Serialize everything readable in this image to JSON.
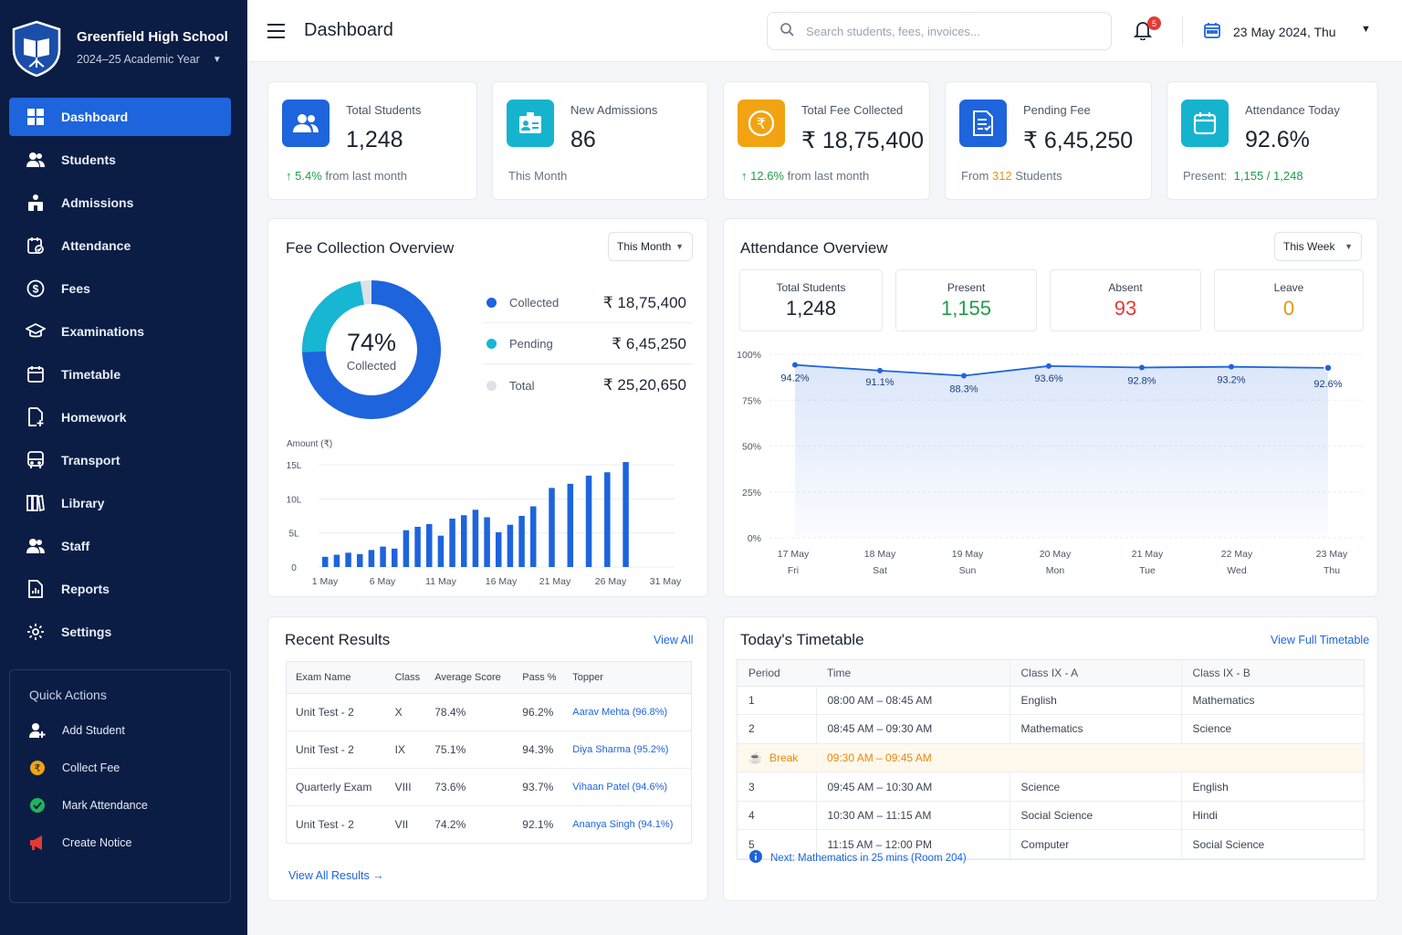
{
  "brand": {
    "school_name": "Greenfield High School",
    "academic_year": "2024–25 Academic Year"
  },
  "sidebar": {
    "items": [
      {
        "label": "Dashboard",
        "icon": "grid-icon",
        "active": true
      },
      {
        "label": "Students",
        "icon": "students-icon"
      },
      {
        "label": "Admissions",
        "icon": "admissions-icon"
      },
      {
        "label": "Attendance",
        "icon": "attendance-icon"
      },
      {
        "label": "Fees",
        "icon": "dollar-icon"
      },
      {
        "label": "Examinations",
        "icon": "graduation-cap-icon"
      },
      {
        "label": "Timetable",
        "icon": "calendar-icon"
      },
      {
        "label": "Homework",
        "icon": "document-plus-icon"
      },
      {
        "label": "Transport",
        "icon": "bus-icon"
      },
      {
        "label": "Library",
        "icon": "books-icon"
      },
      {
        "label": "Staff",
        "icon": "staff-icon"
      },
      {
        "label": "Reports",
        "icon": "report-icon"
      },
      {
        "label": "Settings",
        "icon": "gear-icon"
      }
    ],
    "quick_actions": {
      "title": "Quick Actions",
      "items": [
        {
          "label": "Add Student",
          "icon": "add-user-icon"
        },
        {
          "label": "Collect Fee",
          "icon": "rupee-coin-icon"
        },
        {
          "label": "Mark Attendance",
          "icon": "check-circle-icon"
        },
        {
          "label": "Create Notice",
          "icon": "megaphone-icon"
        }
      ]
    }
  },
  "header": {
    "title": "Dashboard",
    "search_placeholder": "Search students, fees, invoices...",
    "notification_count": "5",
    "date": "23 May 2024, Thu"
  },
  "stats": [
    {
      "label": "Total Students",
      "value": "1,248",
      "trend": "5.4%",
      "trend_text": "from last month",
      "icon": "users-icon",
      "color": "#1d64dd"
    },
    {
      "label": "New Admissions",
      "value": "86",
      "sub": "This Month",
      "icon": "id-card-icon",
      "color": "#16b3cf"
    },
    {
      "label": "Total Fee Collected",
      "value": "₹ 18,75,400",
      "trend": "12.6%",
      "trend_text": "from last month",
      "icon": "rupee-icon",
      "color": "#f2a312"
    },
    {
      "label": "Pending Fee",
      "value": "₹ 6,45,250",
      "sub_prefix": "From",
      "sub_count": "312",
      "sub_suffix": "Students",
      "icon": "invoice-icon",
      "color": "#1d64dd"
    },
    {
      "label": "Attendance Today",
      "value": "92.6%",
      "sub_prefix": "Present:",
      "sub_value": "1,155 / 1,248",
      "icon": "calendar-icon",
      "color": "#16b3cf"
    }
  ],
  "fee_overview": {
    "title": "Fee Collection Overview",
    "filter": "This Month",
    "donut_percent": "74%",
    "donut_label": "Collected",
    "donut_fraction": 0.744,
    "legend": [
      {
        "label": "Collected",
        "amount": "₹ 18,75,400",
        "color": "#1d64dd"
      },
      {
        "label": "Pending",
        "amount": "₹ 6,45,250",
        "color": "#17b6d3"
      },
      {
        "label": "Total",
        "amount": "₹ 25,20,650",
        "color": "#dde1e8"
      }
    ]
  },
  "attendance": {
    "title": "Attendance Overview",
    "filter": "This Week",
    "summary": [
      {
        "label": "Total Students",
        "value": "1,248",
        "color": "#1b2430"
      },
      {
        "label": "Present",
        "value": "1,155",
        "color": "#1e9e4a"
      },
      {
        "label": "Absent",
        "value": "93",
        "color": "#e53935"
      },
      {
        "label": "Leave",
        "value": "0",
        "color": "#e89413"
      }
    ]
  },
  "chart_data": [
    {
      "type": "bar",
      "ylabel": "Amount (₹)",
      "ytick_labels": [
        "0",
        "5L",
        "10L",
        "15L"
      ],
      "ylim": [
        0,
        15
      ],
      "xtick_labels": [
        "1 May",
        "6 May",
        "11 May",
        "16 May",
        "21 May",
        "26 May",
        "31 May"
      ],
      "categories": [
        "1",
        "2",
        "3",
        "4",
        "5",
        "6",
        "7",
        "8",
        "9",
        "10",
        "11",
        "12",
        "13",
        "14",
        "15",
        "16",
        "17",
        "18",
        "19",
        "20",
        "21",
        "22",
        "23",
        "24",
        "25",
        "26",
        "27",
        "28",
        "29",
        "30",
        "31"
      ],
      "values": [
        1.5,
        1.8,
        2.1,
        1.9,
        2.5,
        3.0,
        2.7,
        5.4,
        5.9,
        6.3,
        4.6,
        7.1,
        7.6,
        8.4,
        7.3,
        5.1,
        6.2,
        7.5,
        8.9,
        11.6,
        12.2,
        13.4,
        13.9,
        15.4
      ],
      "xindex": [
        1,
        2,
        3,
        4,
        5,
        6,
        7,
        8,
        9,
        10,
        11,
        12,
        13,
        14,
        15,
        16,
        17,
        18,
        19,
        20,
        21,
        22,
        23,
        24
      ],
      "color": "#1d64dd",
      "grid": true
    },
    {
      "type": "area",
      "ytick_labels": [
        "0%",
        "25%",
        "50%",
        "75%",
        "100%"
      ],
      "ylim": [
        0,
        100
      ],
      "x_dates": [
        "17 May",
        "18 May",
        "19 May",
        "20 May",
        "21 May",
        "22 May",
        "23 May"
      ],
      "x_days": [
        "Fri",
        "Sat",
        "Sun",
        "Mon",
        "Tue",
        "Wed",
        "Thu"
      ],
      "values": [
        94.2,
        91.1,
        88.3,
        93.6,
        92.8,
        93.2,
        92.6
      ],
      "labels": [
        "94.2%",
        "91.1%",
        "88.3%",
        "93.6%",
        "92.8%",
        "93.2%",
        "92.6%"
      ],
      "color": "#1d64dd",
      "grid": true
    }
  ],
  "results": {
    "title": "Recent Results",
    "view_all": "View All",
    "columns": [
      "Exam Name",
      "Class",
      "Average Score",
      "Pass %",
      "Topper"
    ],
    "rows": [
      [
        "Unit Test - 2",
        "X",
        "78.4%",
        "96.2%",
        "Aarav Mehta (96.8%)"
      ],
      [
        "Unit Test - 2",
        "IX",
        "75.1%",
        "94.3%",
        "Diya Sharma (95.2%)"
      ],
      [
        "Quarterly Exam",
        "VIII",
        "73.6%",
        "93.7%",
        "Vihaan Patel (94.6%)"
      ],
      [
        "Unit Test - 2",
        "VII",
        "74.2%",
        "92.1%",
        "Ananya Singh (94.1%)"
      ]
    ],
    "view_all_results": "View All Results"
  },
  "timetable": {
    "title": "Today's Timetable",
    "view_full": "View Full Timetable",
    "columns": [
      "Period",
      "Time",
      "Class IX - A",
      "Class IX - B"
    ],
    "rows": [
      [
        "1",
        "08:00 AM – 08:45 AM",
        "English",
        "Mathematics"
      ],
      [
        "2",
        "08:45 AM – 09:30 AM",
        "Mathematics",
        "Science"
      ],
      [
        "Break",
        "09:30 AM – 09:45 AM",
        "",
        ""
      ],
      [
        "3",
        "09:45 AM – 10:30 AM",
        "Science",
        "English"
      ],
      [
        "4",
        "10:30 AM – 11:15 AM",
        "Social Science",
        "Hindi"
      ],
      [
        "5",
        "11:15 AM – 12:00 PM",
        "Computer",
        "Social Science"
      ]
    ],
    "next": "Next: Mathematics in 25 mins (Room 204)"
  }
}
